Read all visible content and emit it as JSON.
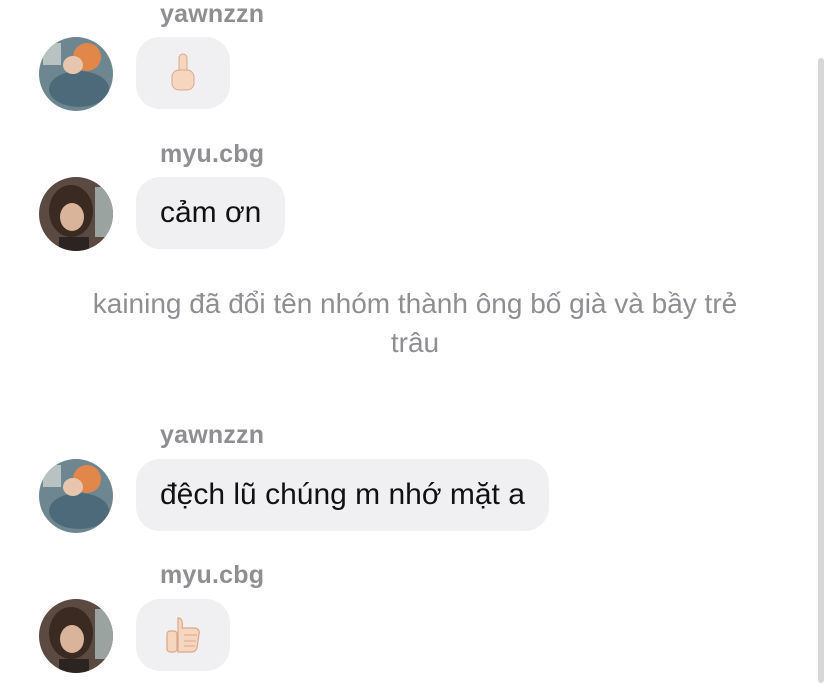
{
  "messages": [
    {
      "sender": "yawnzzn",
      "emoji": "middle-finger"
    },
    {
      "sender": "myu.cbg",
      "text": "cảm ơn"
    },
    {
      "sender": "yawnzzn",
      "text": "đệch lũ chúng m nhớ mặt a"
    },
    {
      "sender": "myu.cbg",
      "emoji": "thumbs-up"
    }
  ],
  "system_message": "kaining đã đổi tên nhóm thành ông bố già và bầy trẻ trâu",
  "colors": {
    "bubble": "#f0f0f2",
    "sender": "#8e8e93",
    "system": "#8e8e93"
  }
}
